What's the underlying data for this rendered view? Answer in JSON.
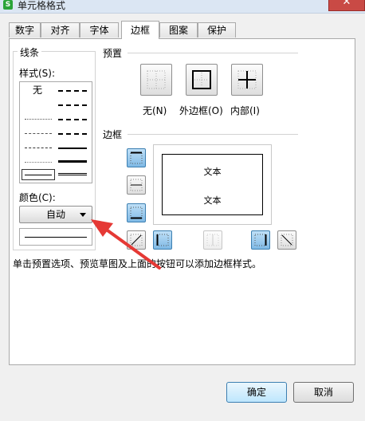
{
  "window": {
    "title": "单元格格式",
    "app_icon": "S"
  },
  "tabs": [
    {
      "label": "数字"
    },
    {
      "label": "对齐"
    },
    {
      "label": "字体"
    },
    {
      "label": "边框",
      "active": true
    },
    {
      "label": "图案"
    },
    {
      "label": "保护"
    }
  ],
  "line": {
    "group_label": "线条",
    "style_label": "样式(S):",
    "none_label": "无",
    "color_label": "颜色(C):",
    "color_value": "自动"
  },
  "preset": {
    "label": "预置",
    "none": "无(N)",
    "outline": "外边框(O)",
    "inside": "内部(I)"
  },
  "border": {
    "label": "边框",
    "preview_text_top": "文本",
    "preview_text_bottom": "文本"
  },
  "hint": "单击预置选项、预览草图及上面的按钮可以添加边框样式。",
  "footer": {
    "ok": "确定",
    "cancel": "取消"
  },
  "colors": {
    "accent_blue": "#7fb9e5",
    "annotation_arrow": "#e53935"
  }
}
